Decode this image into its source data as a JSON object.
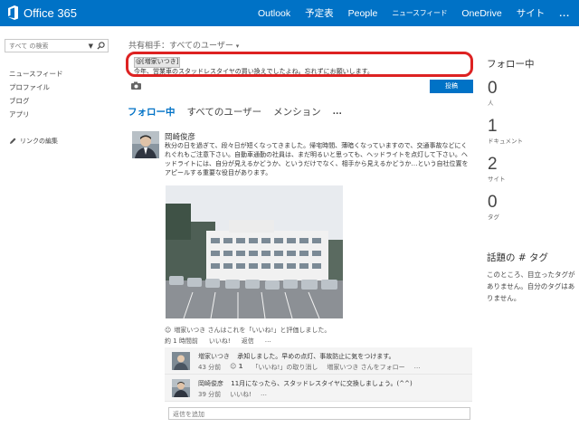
{
  "header": {
    "brand": "Office 365",
    "nav": [
      {
        "label": "Outlook"
      },
      {
        "label": "予定表"
      },
      {
        "label": "People"
      },
      {
        "label": "ニュースフィード"
      },
      {
        "label": "OneDrive"
      },
      {
        "label": "サイト"
      },
      {
        "label": "..."
      }
    ],
    "color": "#0072c6"
  },
  "sidebar": {
    "search_placeholder": "すべて の検索",
    "items": [
      {
        "label": "ニュースフィード"
      },
      {
        "label": "プロファイル"
      },
      {
        "label": "ブログ"
      },
      {
        "label": "アプリ"
      }
    ],
    "edit_links": "リンクの編集"
  },
  "compose": {
    "share_label": "共有相手：すべてのユーザー",
    "mention": "@[増家いつき]",
    "text": "今年、営業車のスタッドレスタイヤの買い換えでしたよね。忘れずにお願いします。",
    "post_label": "投稿"
  },
  "tabs": [
    {
      "label": "フォロー中"
    },
    {
      "label": "すべてのユーザー"
    },
    {
      "label": "メンション"
    },
    {
      "label": "..."
    }
  ],
  "post": {
    "author": "岡崎俊彦",
    "body": "秋分の日を過ぎて、段々日が短くなってきました。帰宅時間、薄暗くなっていますので、交通事故などにくれぐれもご注意下さい。自動車通勤の社員は、まだ明るいと思っても、ヘッドライトを点灯して下さい。ヘッドライトには、自分が見えるかどうか、というだけでなく、相手から見えるかどうか…という自社位置をアピールする重要な役目があります。",
    "likes": "増家いつき さんはこれを「いいね!」と評価しました。",
    "time": "約 1 時間前",
    "like_label": "いいね!",
    "reply_label": "返信",
    "more_label": "…"
  },
  "replies": [
    {
      "author": "増家いつき",
      "text": "承知しました。早めの点灯、事故防止に気をつけます。",
      "time": "43 分前",
      "count": "1",
      "unlike_label": "「いいね!」の取り消し",
      "follow_label": "増家いつき さんをフォロー",
      "more_label": "…"
    },
    {
      "author": "岡崎俊彦",
      "text": "11月になったら、スタッドレスタイヤに交換しましょう。(^^)",
      "time": "39 分前",
      "like_label": "いいね!",
      "more_label": "…"
    }
  ],
  "reply_placeholder": "返信を追加",
  "following": {
    "title": "フォロー中",
    "stats": [
      {
        "value": "0",
        "label": "人"
      },
      {
        "value": "1",
        "label": "ドキュメント"
      },
      {
        "value": "2",
        "label": "サイト"
      },
      {
        "value": "0",
        "label": "タグ"
      }
    ]
  },
  "topics": {
    "title": "話題の # タグ",
    "body": "このところ、目立ったタグがありません。自分のタグはありません。"
  }
}
